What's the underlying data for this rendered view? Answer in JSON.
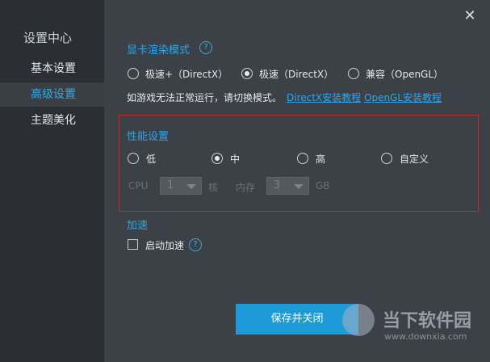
{
  "sidebar": {
    "title": "设置中心",
    "items": [
      {
        "label": "基本设置",
        "active": false
      },
      {
        "label": "高级设置",
        "active": true
      },
      {
        "label": "主题美化",
        "active": false
      }
    ]
  },
  "close_glyph": "✕",
  "gpu": {
    "title": "显卡渲染模式",
    "help_glyph": "?",
    "options": [
      {
        "label": "极速+（DirectX）",
        "checked": false
      },
      {
        "label": "极速（DirectX）",
        "checked": true
      },
      {
        "label": "兼容（OpenGL）",
        "checked": false
      }
    ],
    "hint": "如游戏无法正常运行，请切换模式。",
    "link_directx": "DirectX安装教程",
    "link_opengl": "OpenGL安装教程"
  },
  "performance": {
    "title": "性能设置",
    "options": [
      {
        "label": "低",
        "checked": false
      },
      {
        "label": "中",
        "checked": true
      },
      {
        "label": "高",
        "checked": false
      },
      {
        "label": "自定义",
        "checked": false
      }
    ],
    "cpu_label": "CPU",
    "cpu_value": "1",
    "cpu_unit": "核",
    "mem_label": "内存",
    "mem_value": "3",
    "mem_unit": "GB"
  },
  "accel": {
    "title": "加速",
    "checkbox_label": "启动加速",
    "checked": false,
    "help_glyph": "?"
  },
  "save_button": "保存并关闭",
  "watermark": {
    "brand": "当下软件园",
    "url": "www.downxia.com"
  },
  "colors": {
    "accent": "#2ea8ea",
    "highlight_border": "#d1232a",
    "sidebar_bg": "#2b2f34",
    "panel_bg": "#3c4047"
  }
}
